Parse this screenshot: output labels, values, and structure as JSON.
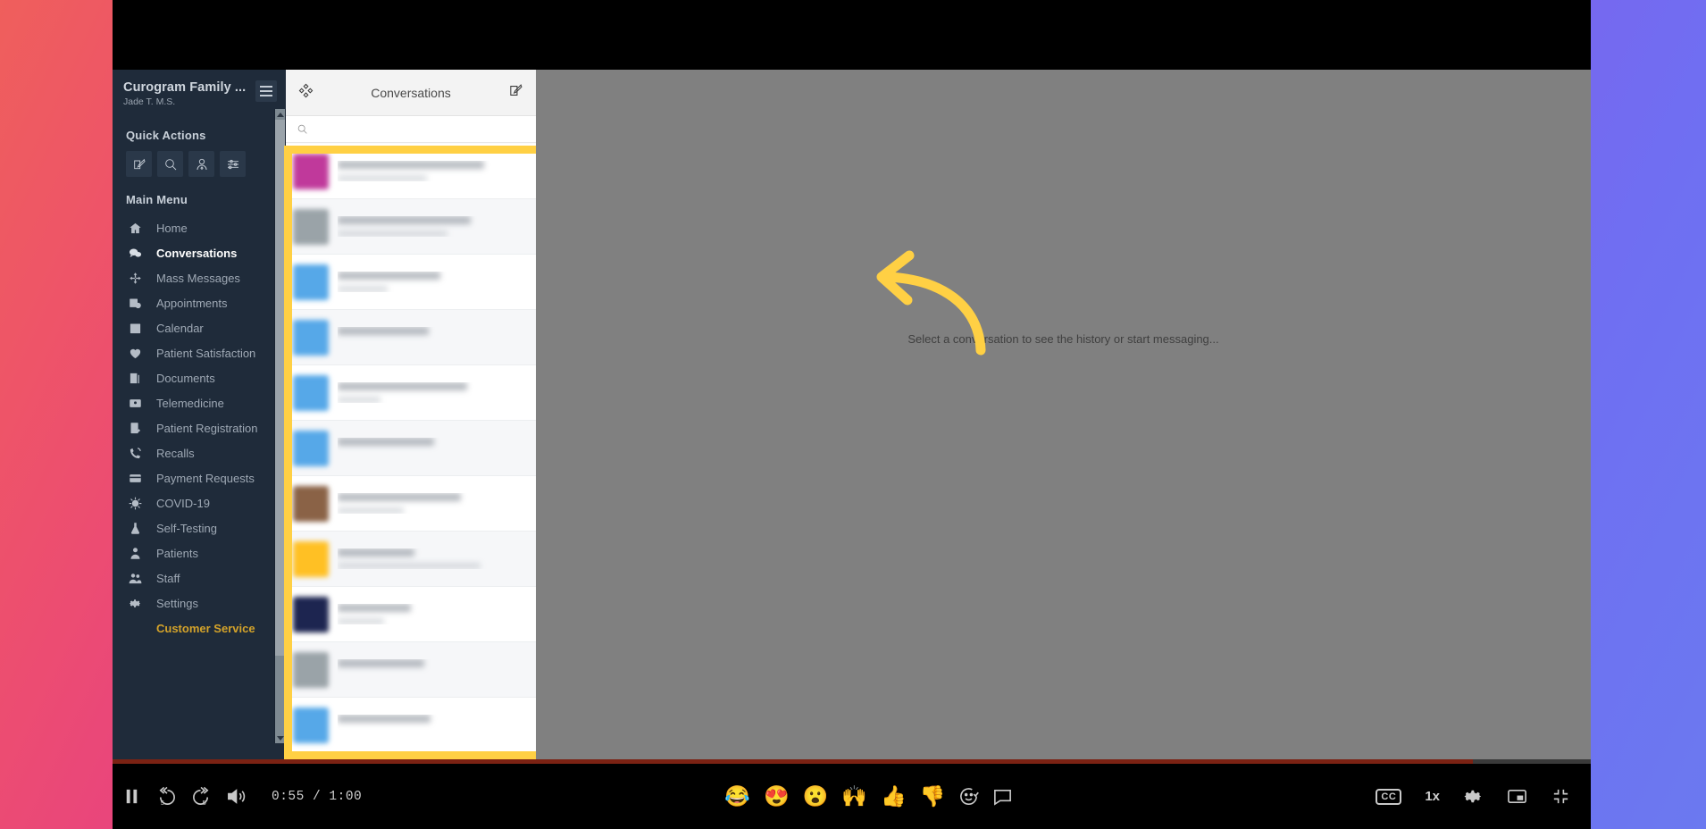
{
  "sidebar": {
    "org_name": "Curogram Family ...",
    "user_name": "Jade T. M.S.",
    "hamburger_label": "menu",
    "quick_actions_title": "Quick Actions",
    "quick_actions": [
      {
        "name": "compose-icon",
        "label": "Compose"
      },
      {
        "name": "search-icon",
        "label": "Search"
      },
      {
        "name": "patient-icon",
        "label": "Patient"
      },
      {
        "name": "filter-icon",
        "label": "Filters"
      }
    ],
    "main_menu_title": "Main Menu",
    "items": [
      {
        "label": "Home",
        "icon": "home-icon",
        "active": false
      },
      {
        "label": "Conversations",
        "icon": "chat-icon",
        "active": true
      },
      {
        "label": "Mass Messages",
        "icon": "broadcast-icon",
        "active": false
      },
      {
        "label": "Appointments",
        "icon": "appointments-icon",
        "active": false
      },
      {
        "label": "Calendar",
        "icon": "calendar-icon",
        "active": false
      },
      {
        "label": "Patient Satisfaction",
        "icon": "heart-icon",
        "active": false
      },
      {
        "label": "Documents",
        "icon": "documents-icon",
        "active": false
      },
      {
        "label": "Telemedicine",
        "icon": "telemedicine-icon",
        "active": false
      },
      {
        "label": "Patient Registration",
        "icon": "registration-icon",
        "active": false
      },
      {
        "label": "Recalls",
        "icon": "recalls-icon",
        "active": false
      },
      {
        "label": "Payment Requests",
        "icon": "card-icon",
        "active": false
      },
      {
        "label": "COVID-19",
        "icon": "virus-icon",
        "active": false
      },
      {
        "label": "Self-Testing",
        "icon": "flask-icon",
        "active": false
      },
      {
        "label": "Patients",
        "icon": "patient-icon",
        "active": false
      },
      {
        "label": "Staff",
        "icon": "staff-icon",
        "active": false
      },
      {
        "label": "Settings",
        "icon": "gear-icon",
        "active": false
      }
    ],
    "customer_service_label": "Customer Service",
    "customer_service_color": "#d4a32a"
  },
  "conversations": {
    "title": "Conversations",
    "compose_icon": "compose-icon",
    "filter_icon": "filter-icon",
    "search_placeholder": "",
    "highlight_color": "#ffd044",
    "rows": [
      {
        "avatar_color": "#c0399b",
        "name": "",
        "snippet": "",
        "meta": ""
      },
      {
        "avatar_color": "#9aa3a8",
        "name": "",
        "snippet": "",
        "meta": ""
      },
      {
        "avatar_color": "#56a8e8",
        "name": "",
        "snippet": "",
        "meta": ""
      },
      {
        "avatar_color": "#56a8e8",
        "name": "",
        "snippet": "",
        "meta": ""
      },
      {
        "avatar_color": "#56a8e8",
        "name": "",
        "snippet": "",
        "meta": ""
      },
      {
        "avatar_color": "#56a8e8",
        "name": "",
        "snippet": "",
        "meta": ""
      },
      {
        "avatar_color": "#8a6246",
        "name": "",
        "snippet": "",
        "meta": ""
      },
      {
        "avatar_color": "#ffc024",
        "name": "",
        "snippet": "",
        "meta": ""
      },
      {
        "avatar_color": "#1d2550",
        "name": "",
        "snippet": "",
        "meta": ""
      },
      {
        "avatar_color": "#9aa3a8",
        "name": "",
        "snippet": "",
        "meta": ""
      },
      {
        "avatar_color": "#56a8e8",
        "name": "",
        "snippet": "",
        "meta": ""
      }
    ]
  },
  "main_pane": {
    "empty_message": "Select a conversation to see the history or start messaging...",
    "annotation_arrow": "curved-left-arrow",
    "annotation_color": "#ffd044"
  },
  "player": {
    "current_time": "0:55",
    "separator": "/",
    "total_time": "1:00",
    "time_display": "0:55 / 1:00",
    "progress_percent": 92,
    "pause_label": "Pause",
    "rewind_label": "5",
    "forward_label": "5",
    "volume_label": "Volume",
    "speed_label": "1x",
    "cc_label": "CC",
    "settings_label": "Settings",
    "pip_label": "Picture in picture",
    "collapse_label": "Exit fullscreen",
    "reactions": [
      {
        "name": "laughing-emoji",
        "glyph": "😂"
      },
      {
        "name": "heart-eyes-emoji",
        "glyph": "😍"
      },
      {
        "name": "surprised-emoji",
        "glyph": "😮"
      },
      {
        "name": "raised-hands-emoji",
        "glyph": "🙌"
      },
      {
        "name": "thumbs-up-emoji",
        "glyph": "👍"
      },
      {
        "name": "thumbs-down-emoji",
        "glyph": "👎"
      }
    ],
    "add-reaction_label": "Add reaction",
    "comment_label": "Comment"
  }
}
